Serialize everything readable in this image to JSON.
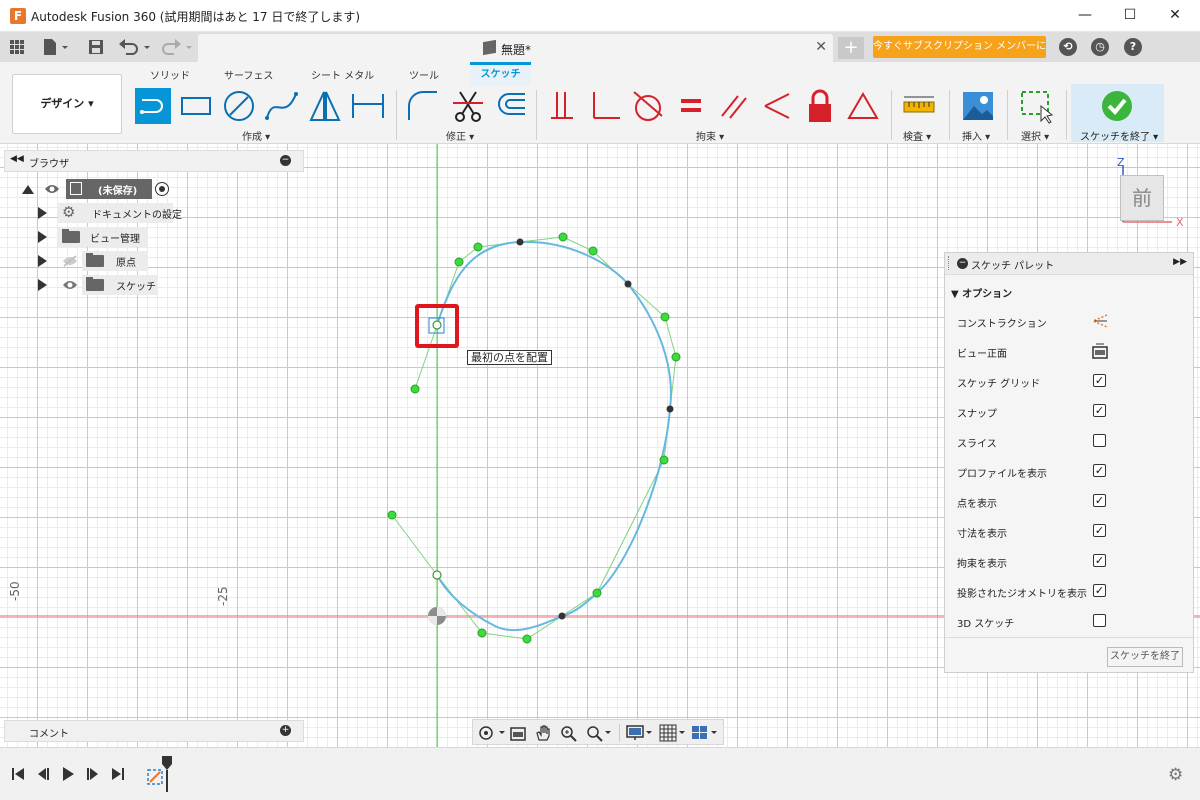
{
  "app": {
    "title": "Autodesk Fusion 360 (試用期間はあと 17 日で終了します)",
    "logo_letter": "F",
    "window_controls": {
      "minimize": "—",
      "maximize": "☐",
      "close": "✕"
    }
  },
  "tabbar": {
    "doc_title": "無題*",
    "close_glyph": "✕",
    "new_tab_glyph": "+",
    "subscribe_label": "今すぐサブスクリプション メンバーに...",
    "icons": [
      "apps-grid-icon",
      "file-icon",
      "save-icon",
      "undo-icon",
      "redo-icon",
      "extensions-icon",
      "job-status-icon",
      "help-icon"
    ]
  },
  "ribbon": {
    "workspace_label": "デザイン",
    "tabs": [
      "ソリッド",
      "サーフェス",
      "シート メタル",
      "ツール",
      "スケッチ"
    ],
    "active_tab": "スケッチ",
    "groups": {
      "create": "作成 ▾",
      "modify": "修正 ▾",
      "constraints": "拘束 ▾",
      "inspect": "検査 ▾",
      "insert": "挿入 ▾",
      "select": "選択 ▾",
      "finish": "スケッチを終了 ▾"
    },
    "accent": "#0696d7",
    "constraint_color": "#d6212b"
  },
  "browser": {
    "title": "ブラウザ",
    "root_label": "(未保存)",
    "items": [
      {
        "label": "ドキュメントの設定",
        "icon": "gear-icon"
      },
      {
        "label": "ビュー管理",
        "icon": "folder-icon"
      },
      {
        "label": "原点",
        "icon": "folder-icon"
      },
      {
        "label": "スケッチ",
        "icon": "folder-icon"
      }
    ]
  },
  "comment": {
    "title": "コメント"
  },
  "viewport": {
    "axis_labels": {
      "z": "Z",
      "x": "X"
    },
    "viewcube_face": "前",
    "ruler_labels": [
      "-50",
      "-25"
    ],
    "tooltip": "最初の点を配置",
    "colors": {
      "curve": "#66b8e0",
      "control": "#3ddc3d",
      "polygon": "#6fcf6f",
      "x_axis": "#e26b6b",
      "y_axis": "#58c858",
      "highlight": "#e0161e"
    }
  },
  "palette": {
    "title": "スケッチ パレット",
    "section": "オプション",
    "options": [
      {
        "label": "コンストラクション",
        "type": "icon",
        "icon": "construction-icon"
      },
      {
        "label": "ビュー正面",
        "type": "icon",
        "icon": "look-at-icon"
      },
      {
        "label": "スケッチ グリッド",
        "type": "checkbox",
        "checked": true
      },
      {
        "label": "スナップ",
        "type": "checkbox",
        "checked": true
      },
      {
        "label": "スライス",
        "type": "checkbox",
        "checked": false
      },
      {
        "label": "プロファイルを表示",
        "type": "checkbox",
        "checked": true
      },
      {
        "label": "点を表示",
        "type": "checkbox",
        "checked": true
      },
      {
        "label": "寸法を表示",
        "type": "checkbox",
        "checked": true
      },
      {
        "label": "拘束を表示",
        "type": "checkbox",
        "checked": true
      },
      {
        "label": "投影されたジオメトリを表示",
        "type": "checkbox",
        "checked": true
      },
      {
        "label": "3D スケッチ",
        "type": "checkbox",
        "checked": false
      }
    ],
    "finish_button": "スケッチを終了",
    "check_glyph": "✓"
  }
}
